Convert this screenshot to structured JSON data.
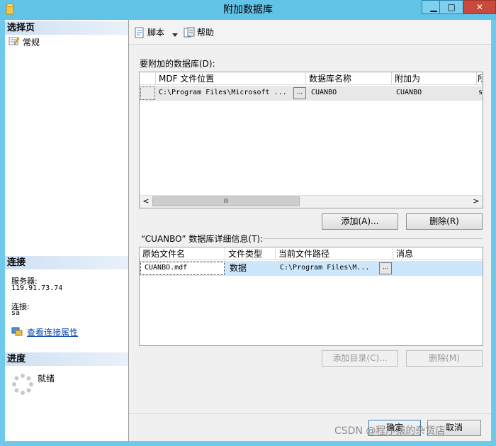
{
  "window": {
    "title": "附加数据库",
    "minimize": "▁",
    "maximize": "□",
    "close": "✕"
  },
  "left": {
    "select_page_header": "选择页",
    "pages": [
      {
        "label": "常规"
      }
    ],
    "connection_header": "连接",
    "server_label": "服务器:",
    "server_value": "119.91.73.74",
    "conn_label": "连接:",
    "conn_value": "sa",
    "view_props_link": "查看连接属性",
    "progress_header": "进度",
    "progress_status": "就绪"
  },
  "toolbar": {
    "script_label": "脚本",
    "help_label": "帮助"
  },
  "databases": {
    "section_label": "要附加的数据库(D):",
    "columns": [
      "MDF 文件位置",
      "数据库名称",
      "附加为",
      "所"
    ],
    "rows": [
      {
        "mdf": "C:\\Program Files\\Microsoft ...",
        "ellipsis": "...",
        "dbname": "CUANBO",
        "attach_as": "CUANBO",
        "extra": "s"
      }
    ],
    "add_button": "添加(A)...",
    "remove_button": "删除(R)",
    "scroll_left": "<",
    "scroll_right": ">",
    "scroll_grip": "III"
  },
  "details": {
    "section_label": "“CUANBO” 数据库详细信息(T):",
    "columns": [
      "原始文件名",
      "文件类型",
      "当前文件路径",
      "消息"
    ],
    "rows": [
      {
        "orig": "CUANBO.mdf",
        "type": "数据",
        "path": "C:\\Program Files\\M...",
        "ellipsis": "...",
        "msg": ""
      }
    ],
    "add_catalog_button": "添加目录(C)...",
    "remove_button": "删除(M)"
  },
  "footer": {
    "ok_button": "确定",
    "cancel_button": "取消",
    "watermark": "CSDN @程序猿的杂货店"
  }
}
